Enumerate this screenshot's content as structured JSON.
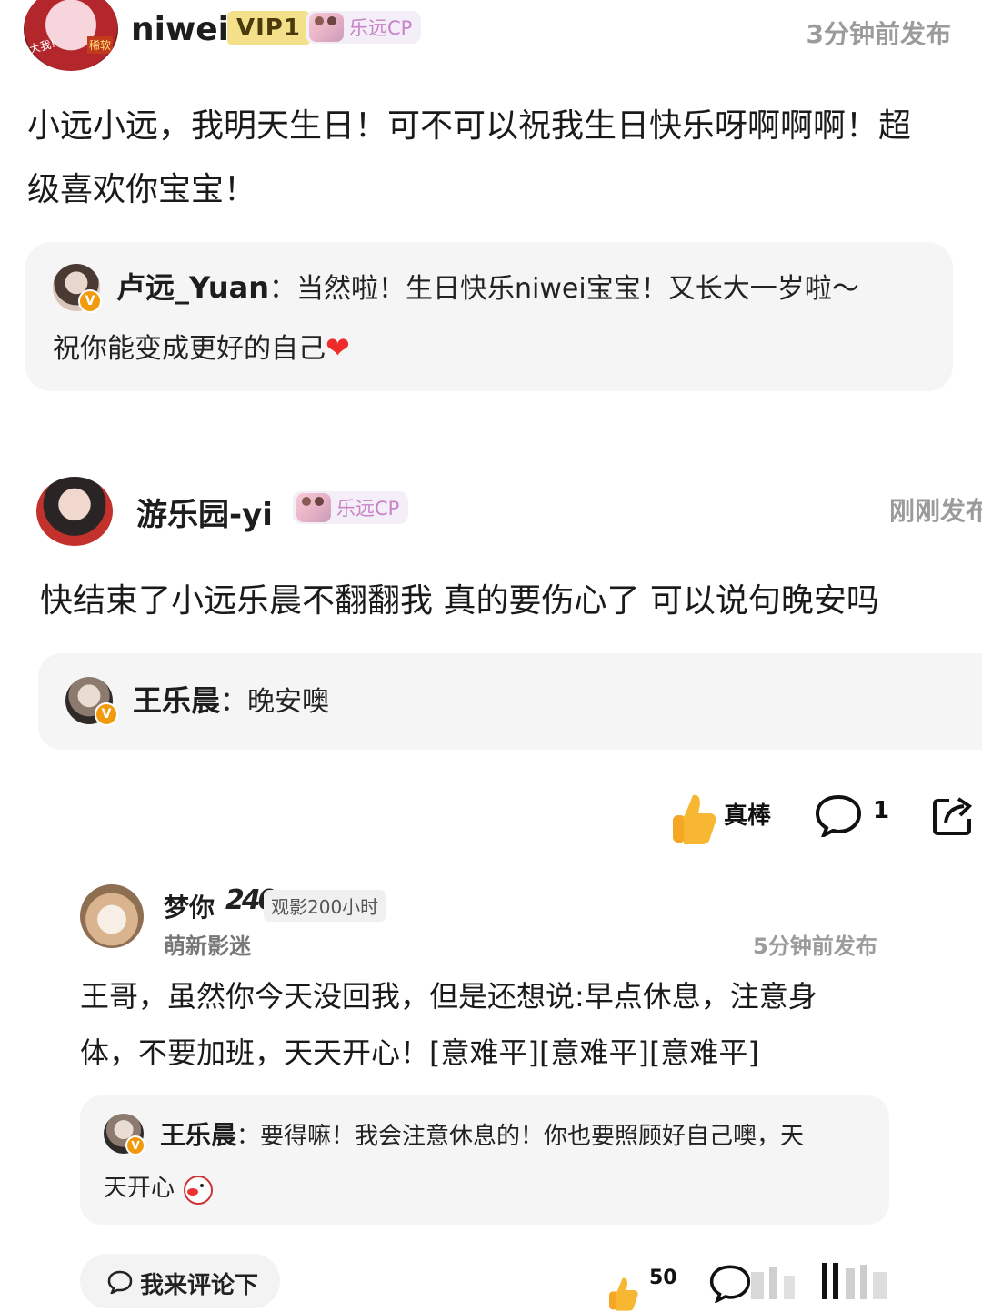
{
  "post1": {
    "username": "niwei",
    "vip_badge": "VIP1",
    "cp_badge": "乐远CP",
    "time": "3分钟前发布",
    "avatar_text": {
      "tl": "大我!",
      "tr": "稀软"
    },
    "text_line1": "小远小远，我明天生日！可不可以祝我生日快乐呀啊啊啊！超",
    "text_line2": "级喜欢你宝宝！",
    "reply": {
      "author": "卢远_Yuan",
      "sep": "：",
      "line1": "当然啦！生日快乐niwei宝宝！又长大一岁啦～",
      "line2": "祝你能变成更好的自己",
      "emoji": "❤"
    }
  },
  "post2": {
    "username": "游乐园-yi",
    "cp_badge": "乐远CP",
    "time": "刚刚发布",
    "text": "快结束了小远乐晨不翻翻我 真的要伤心了 可以说句晚安吗",
    "reply": {
      "author": "王乐晨",
      "sep": "：",
      "text": "晚安噢"
    },
    "actions": {
      "like_label": "真棒",
      "comment_count": "1"
    }
  },
  "post3": {
    "username": "梦你",
    "level_badge": "240",
    "watch_badge": "观影200小时",
    "subtitle": "萌新影迷",
    "time": "5分钟前发布",
    "text_line1": "王哥，虽然你今天没回我，但是还想说:早点休息，注意身",
    "text_line2": "体，不要加班，天天开心！[意难平][意难平][意难平]",
    "reply": {
      "author": "王乐晨",
      "sep": "：",
      "line1": "要得嘛！我会注意休息的！你也要照顾好自己噢，天",
      "line2": "天开心"
    },
    "actions": {
      "comment_input": "我来评论下",
      "like_count": "50"
    }
  },
  "colors": {
    "verified": "#f29a0e",
    "vip": "#f4df8a",
    "cp_text": "#c983c6",
    "bubble": "#f5f5f5"
  }
}
